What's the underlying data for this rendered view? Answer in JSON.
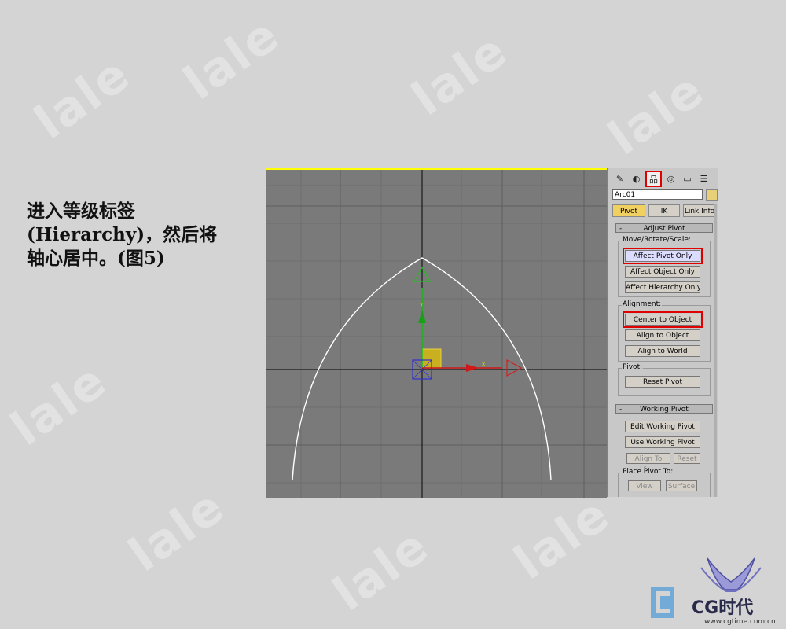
{
  "watermark": "lale",
  "instruction": {
    "lines": [
      " 进入等级标签",
      "(Hierarchy)，然后将",
      "轴心居中。(图5)"
    ]
  },
  "viewport": {
    "background": "#7a7a7a",
    "active_border": "#ffff00",
    "gizmo": {
      "x_label": "x",
      "y_label": "y"
    }
  },
  "panel": {
    "tabs": [
      {
        "icon": "create-icon",
        "glyph": "✎"
      },
      {
        "icon": "modify-icon",
        "glyph": "◐"
      },
      {
        "icon": "hierarchy-icon",
        "glyph": "品",
        "active": true
      },
      {
        "icon": "motion-icon",
        "glyph": "◎"
      },
      {
        "icon": "display-icon",
        "glyph": "▭"
      },
      {
        "icon": "utilities-icon",
        "glyph": "☰"
      }
    ],
    "object_name": "Arc01",
    "object_color": "#e8d078",
    "modes": {
      "pivot": "Pivot",
      "ik": "IK",
      "link_info": "Link Info"
    },
    "adjust_pivot": {
      "title": "Adjust Pivot",
      "collapse": "-",
      "move_group": "Move/Rotate/Scale:",
      "affect_pivot_only": "Affect Pivot Only",
      "affect_object_only": "Affect Object Only",
      "affect_hierarchy_only": "Affect Hierarchy Only",
      "alignment_group": "Alignment:",
      "center_to_object": "Center to Object",
      "align_to_object": "Align to Object",
      "align_to_world": "Align to World",
      "pivot_group": "Pivot:",
      "reset_pivot": "Reset Pivot"
    },
    "working_pivot": {
      "title": "Working Pivot",
      "collapse": "-",
      "edit_working_pivot": "Edit Working Pivot",
      "use_working_pivot": "Use Working Pivot",
      "align_to_view": "Align To View",
      "reset": "Reset",
      "place_pivot_group": "Place Pivot To:",
      "view": "View",
      "surface": "Surface"
    }
  },
  "logo": {
    "text": "CG时代",
    "url": "www.cgtime.com.cn"
  }
}
